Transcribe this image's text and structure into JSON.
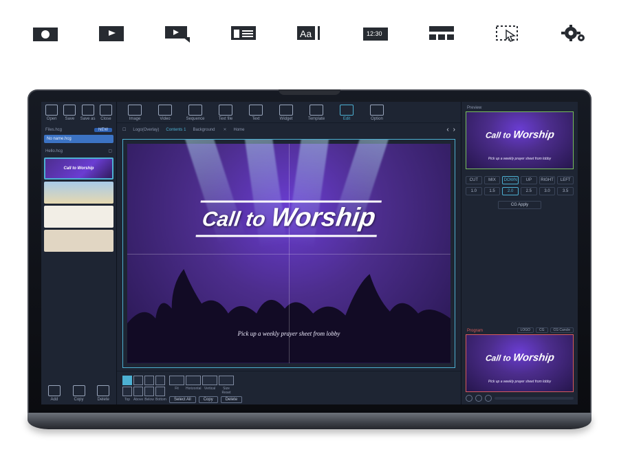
{
  "top_icons": [
    "camera",
    "video-player",
    "presenter",
    "text-lines",
    "font",
    "clock-panel",
    "grid",
    "select",
    "gear"
  ],
  "file_ops": [
    {
      "label": "Open"
    },
    {
      "label": "Save"
    },
    {
      "label": "Save as"
    },
    {
      "label": "Close"
    }
  ],
  "files_panel": {
    "title": "Files.hcg",
    "new": "NEW",
    "row": "No name.hcg"
  },
  "hello_panel": {
    "title": "Hello.hcg"
  },
  "left_foot": [
    {
      "label": "Add"
    },
    {
      "label": "Copy"
    },
    {
      "label": "Delete"
    }
  ],
  "center_toolbar": [
    {
      "label": "Image"
    },
    {
      "label": "Video"
    },
    {
      "label": "Sequence"
    },
    {
      "label": "Text file"
    },
    {
      "label": "Text"
    },
    {
      "label": "Widget"
    },
    {
      "label": "Template"
    },
    {
      "label": "Edit",
      "active": true
    },
    {
      "label": "Option"
    }
  ],
  "tabs": [
    {
      "label": "Logo(Overlay)"
    },
    {
      "label": "Contents",
      "active": true,
      "badge": "1"
    },
    {
      "label": "Background"
    },
    {
      "label": "Home"
    }
  ],
  "canvas": {
    "title_a": "Call to ",
    "title_b": "Worship",
    "subtitle": "Pick up a weekly prayer sheet from lobby"
  },
  "align": {
    "tool_row": [
      "sel",
      "",
      "",
      ""
    ],
    "row1": [
      "Top",
      "Above",
      "Below",
      "Bottom"
    ],
    "row2": [
      "Fit",
      "Horizontal",
      "Vertical",
      "Size Reset"
    ],
    "pills": [
      "Select All",
      "Copy",
      "Delete"
    ]
  },
  "right": {
    "preview_label": "Preview",
    "trans_types": [
      "CUT",
      "MIX",
      "DOWN",
      "UP",
      "RIGHT",
      "LEFT"
    ],
    "trans_active": "DOWN",
    "durations": [
      "1.0",
      "1.5",
      "2.0",
      "2.5",
      "3.0",
      "3.5"
    ],
    "dur_active": "2.0",
    "apply": "CG Apply",
    "program_label": "Program",
    "prog_tags": [
      "LOGO",
      "CG",
      "CG Cancle"
    ]
  }
}
